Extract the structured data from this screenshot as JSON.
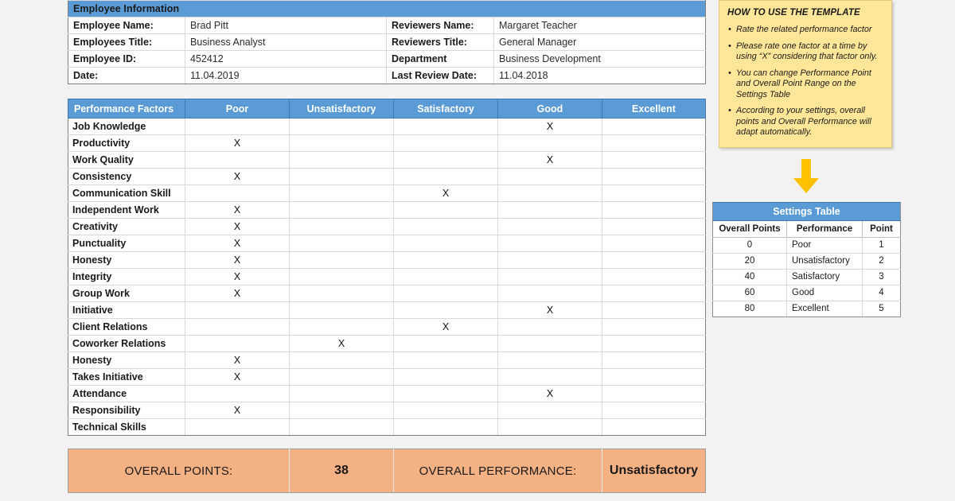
{
  "employee_info": {
    "title": "Employee Information",
    "left_rows": [
      {
        "label": "Employee Name:",
        "value": "Brad Pitt"
      },
      {
        "label": "Employees Title:",
        "value": "Business Analyst"
      },
      {
        "label": "Employee ID:",
        "value": "452412"
      },
      {
        "label": "Date:",
        "value": "11.04.2019"
      }
    ],
    "right_rows": [
      {
        "label": "Reviewers Name:",
        "value": "Margaret Teacher"
      },
      {
        "label": "Reviewers Title:",
        "value": "General Manager"
      },
      {
        "label": "Department",
        "value": "Business Development"
      },
      {
        "label": "Last Review Date:",
        "value": "11.04.2018"
      }
    ]
  },
  "performance": {
    "headers": [
      "Performance Factors",
      "Poor",
      "Unsatisfactory",
      "Satisfactory",
      "Good",
      "Excellent"
    ],
    "mark": "X",
    "rows": [
      {
        "factor": "Job Knowledge",
        "rating": "Good"
      },
      {
        "factor": "Productivity",
        "rating": "Poor"
      },
      {
        "factor": "Work Quality",
        "rating": "Good"
      },
      {
        "factor": "Consistency",
        "rating": "Poor"
      },
      {
        "factor": "Communication Skill",
        "rating": "Satisfactory"
      },
      {
        "factor": "Independent Work",
        "rating": "Poor"
      },
      {
        "factor": "Creativity",
        "rating": "Poor"
      },
      {
        "factor": "Punctuality",
        "rating": "Poor"
      },
      {
        "factor": "Honesty",
        "rating": "Poor"
      },
      {
        "factor": "Integrity",
        "rating": "Poor"
      },
      {
        "factor": "Group Work",
        "rating": "Poor"
      },
      {
        "factor": "Initiative",
        "rating": "Good"
      },
      {
        "factor": "Client Relations",
        "rating": "Satisfactory"
      },
      {
        "factor": "Coworker Relations",
        "rating": "Unsatisfactory"
      },
      {
        "factor": "Honesty",
        "rating": "Poor"
      },
      {
        "factor": "Takes Initiative",
        "rating": "Poor"
      },
      {
        "factor": "Attendance",
        "rating": "Good"
      },
      {
        "factor": "Responsibility",
        "rating": "Poor"
      },
      {
        "factor": "Technical Skills",
        "rating": ""
      }
    ]
  },
  "overall": {
    "points_label": "OVERALL POINTS:",
    "points_value": "38",
    "performance_label": "OVERALL PERFORMANCE:",
    "performance_value": "Unsatisfactory"
  },
  "how_to": {
    "title": "HOW TO USE THE TEMPLATE",
    "bullets": [
      "Rate the related performance factor",
      "Please rate one factor at a time by using “X” considering that factor only.",
      "You can change Performance Point and Overall Point Range on the Settings Table",
      "According to your settings, overall points and Overall Performance will adapt automatically."
    ]
  },
  "arrow": {
    "icon": "arrow-down-icon",
    "color": "#ffc000"
  },
  "settings_table": {
    "title": "Settings Table",
    "headers": [
      "Overall Points",
      "Performance",
      "Point"
    ],
    "rows": [
      {
        "overall_points": "0",
        "performance": "Poor",
        "point": "1"
      },
      {
        "overall_points": "20",
        "performance": "Unsatisfactory",
        "point": "2"
      },
      {
        "overall_points": "40",
        "performance": "Satisfactory",
        "point": "3"
      },
      {
        "overall_points": "60",
        "performance": "Good",
        "point": "4"
      },
      {
        "overall_points": "80",
        "performance": "Excellent",
        "point": "5"
      }
    ]
  },
  "colors": {
    "header_blue": "#5b9bd5",
    "summary_orange": "#f4b183",
    "note_yellow": "#ffe699",
    "arrow_yellow": "#ffc000",
    "page_background": "#f2f2f2"
  }
}
